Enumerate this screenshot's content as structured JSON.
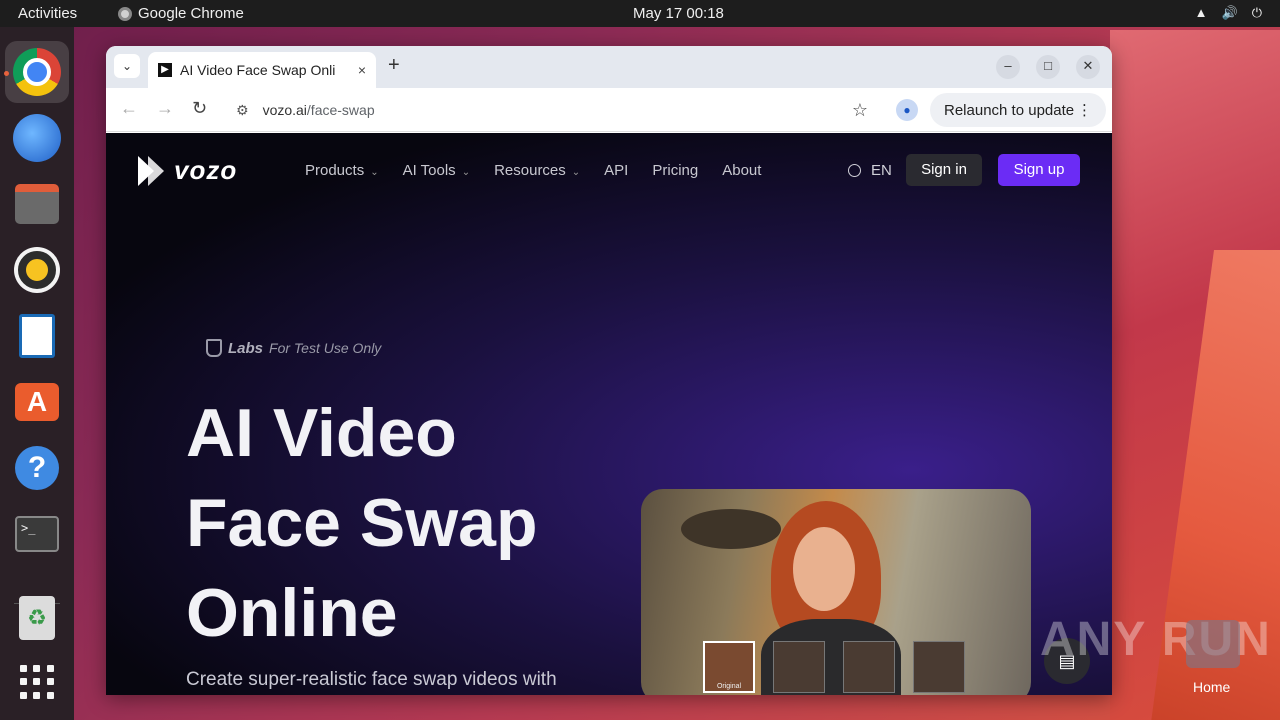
{
  "topbar": {
    "activities": "Activities",
    "app_name": "Google Chrome",
    "clock": "May 17  00:18"
  },
  "dock": {
    "items": [
      "chrome-icon",
      "thunderbird-icon",
      "files-icon",
      "rhythmbox-icon",
      "writer-icon",
      "app-center-icon",
      "help-icon",
      "terminal-icon",
      "trash-icon",
      "show-apps-icon"
    ]
  },
  "browser": {
    "tab_title": "AI Video Face Swap Onli",
    "tab_close": "×",
    "new_tab": "+",
    "url_host": "vozo.ai",
    "url_path": "/face-swap",
    "relaunch_label": "Relaunch to update"
  },
  "site": {
    "logo_text": "vozo",
    "nav": [
      {
        "label": "Products",
        "has_menu": true
      },
      {
        "label": "AI Tools",
        "has_menu": true
      },
      {
        "label": "Resources",
        "has_menu": true
      },
      {
        "label": "API",
        "has_menu": false
      },
      {
        "label": "Pricing",
        "has_menu": false
      },
      {
        "label": "About",
        "has_menu": false
      }
    ],
    "lang": "EN",
    "signin_label": "Sign in",
    "signup_label": "Sign up",
    "labs_word": "Labs",
    "labs_note": "For Test Use Only",
    "hero_lines": [
      "AI Video",
      "Face Swap",
      "Online"
    ],
    "subtitle": "Create super-realistic face swap videos with",
    "thumbs": [
      "Original",
      "",
      "",
      ""
    ],
    "accent_color": "#6b2cf5"
  },
  "desktop": {
    "watermark": "ANY RUN",
    "home_label": "Home"
  }
}
